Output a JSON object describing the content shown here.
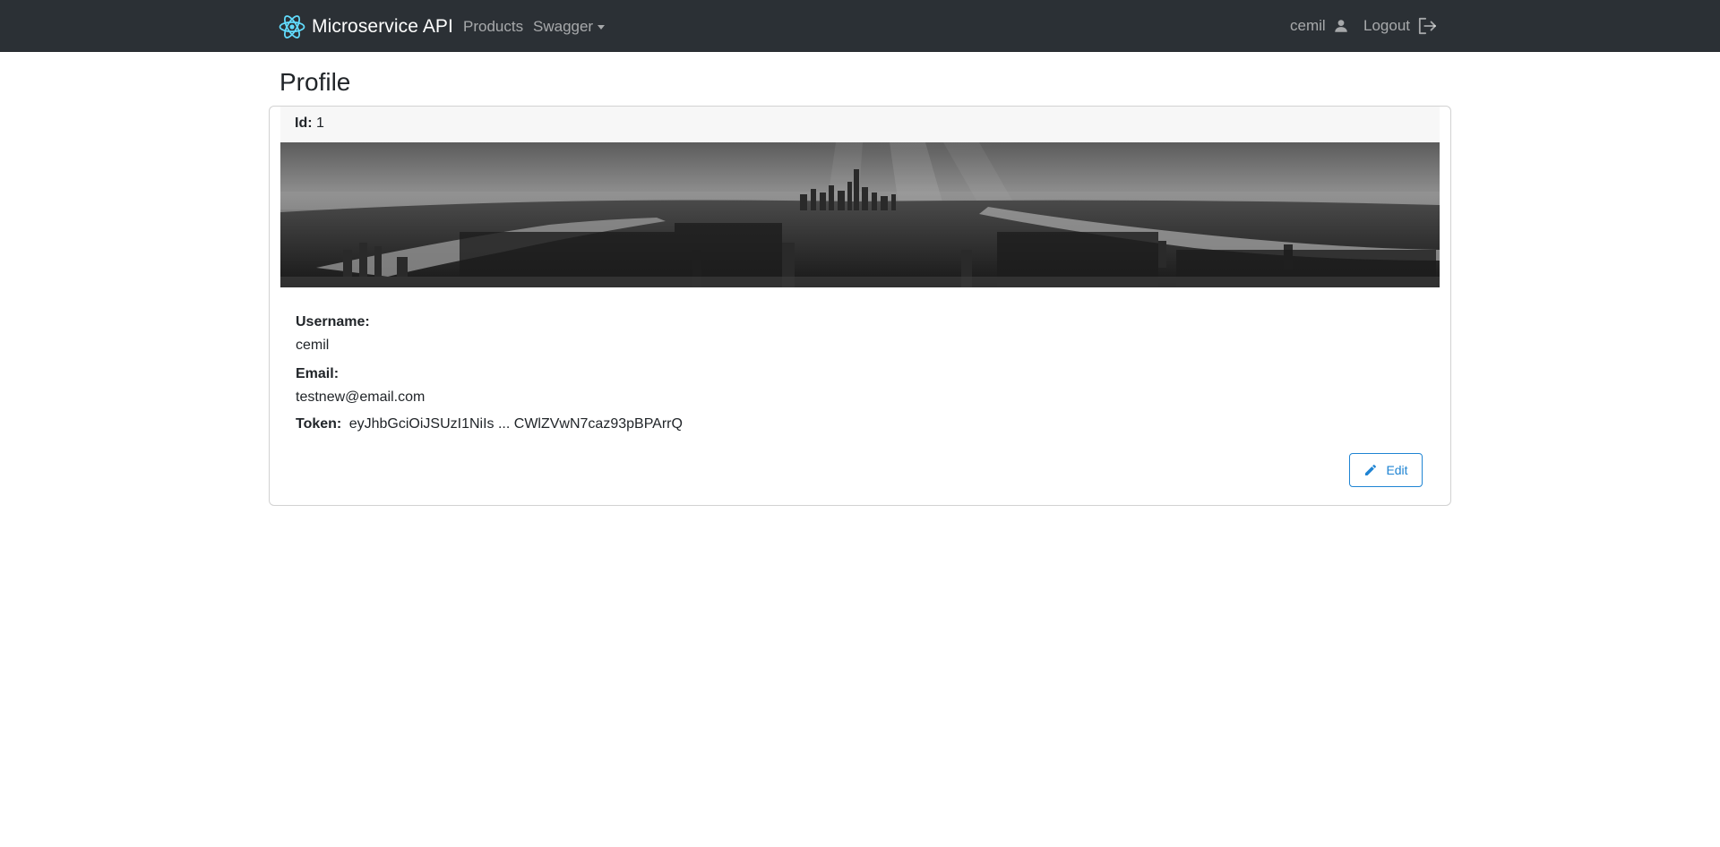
{
  "navbar": {
    "brand": "Microservice API",
    "links": [
      {
        "label": "Products"
      },
      {
        "label": "Swagger"
      }
    ],
    "user": {
      "name": "cemil",
      "icon": "user-icon"
    },
    "logout": {
      "label": "Logout",
      "icon": "logout-icon"
    },
    "brand_icon": "react-logo-icon",
    "accent_color": "#61dafb"
  },
  "page": {
    "title": "Profile"
  },
  "profile": {
    "id_label": "Id:",
    "id": "1",
    "banner": "city-skyline-image",
    "username_label": "Username:",
    "username": "cemil",
    "email_label": "Email:",
    "email": "testnew@email.com",
    "token_label": "Token:",
    "token": "eyJhbGciOiJSUzI1NiIs ... CWlZVwN7caz93pBPArrQ",
    "edit_button": {
      "label": "Edit",
      "icon": "pencil-icon",
      "color": "#1f84d3"
    }
  }
}
